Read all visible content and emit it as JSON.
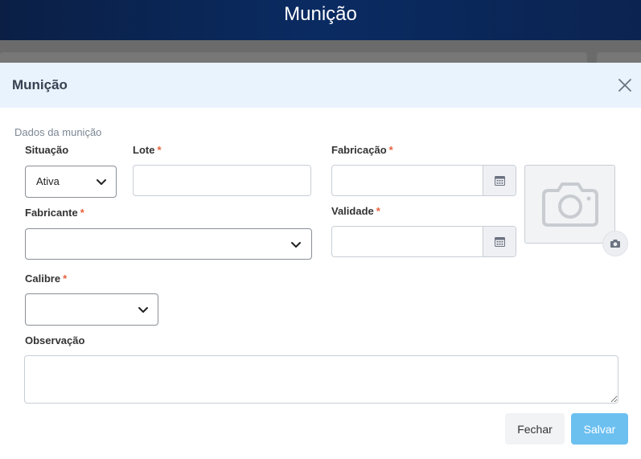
{
  "app": {
    "title": "Munição"
  },
  "modal": {
    "title": "Munição",
    "section_title": "Dados da munição",
    "required_mark": "*",
    "fields": {
      "situacao": {
        "label": "Situação",
        "value": "Ativa"
      },
      "lote": {
        "label": "Lote",
        "value": ""
      },
      "fabricacao": {
        "label": "Fabricação",
        "value": ""
      },
      "fabricante": {
        "label": "Fabricante",
        "value": ""
      },
      "validade": {
        "label": "Validade",
        "value": ""
      },
      "calibre": {
        "label": "Calibre",
        "value": ""
      },
      "observacao": {
        "label": "Observação",
        "value": ""
      }
    },
    "buttons": {
      "close": "Fechar",
      "save": "Salvar"
    }
  },
  "icons": {
    "close": "close-icon",
    "calendar": "calendar-icon",
    "camera": "camera-icon",
    "chevron": "chevron-down-icon"
  },
  "colors": {
    "header_bg": "#0a2b62",
    "modal_header_bg": "#e9f3fd",
    "required": "#e8613a",
    "save_button": "#6cc0f0"
  }
}
